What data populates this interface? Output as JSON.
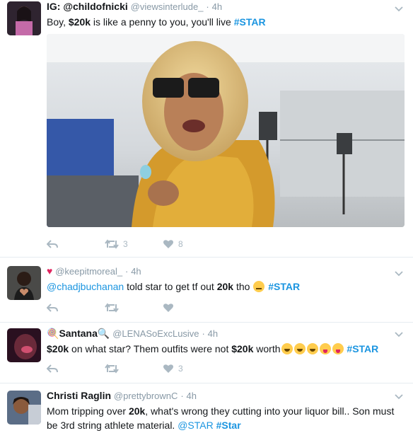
{
  "tweets": [
    {
      "name": "IG: @childofnicki",
      "handle": "@viewsinterlude_",
      "dot": "·",
      "time": "4h",
      "text_parts": [
        "Boy, ",
        "$20k",
        " is like a penny to you, you'll live ",
        "#STAR"
      ],
      "has_media": true,
      "retweets": "3",
      "likes": "8"
    },
    {
      "name_prefix_icon": "red-heart-icon",
      "handle": "@keepitmoreal_",
      "dot": "·",
      "time": "4h",
      "mention": "@chadjbuchanan",
      "text_parts": [
        " told star to get tf out ",
        "20k",
        " tho ",
        "#STAR"
      ],
      "retweets": "",
      "likes": ""
    },
    {
      "name": "Santana",
      "handle": "@LENASoExcLusive",
      "dot": "·",
      "time": "4h",
      "text_parts": [
        "$20k",
        " on what star? Them outfits were not ",
        "$20k",
        " worth",
        "#STAR"
      ],
      "retweets": "",
      "likes": "3"
    },
    {
      "name": "Christi Raglin",
      "handle": "@prettybrownC",
      "dot": "·",
      "time": "4h",
      "text_parts": [
        "Mom tripping over ",
        "20k",
        ", what's wrong they cutting into your liquor bill.. Son must be 3rd string athlete material. ",
        "@STAR",
        " ",
        "#Star"
      ]
    }
  ],
  "colors": {
    "accent": "#1b95e0",
    "muted": "#8899a6",
    "icon": "#aab8c2",
    "heart": "#e0245e",
    "divider": "#e6ecf0"
  }
}
